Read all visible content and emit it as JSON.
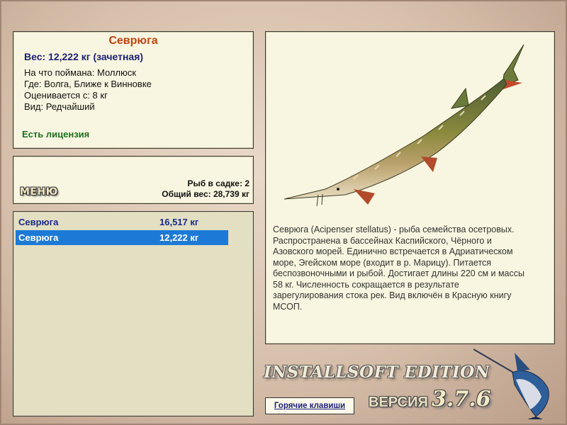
{
  "catch_info": {
    "species": "Севрюга",
    "weight": "Вес: 12,222 кг (зачетная)",
    "caught_on": "На что поймана: Моллюск",
    "location": "Где: Волга, Ближе к Винновке",
    "valued_from": "Оценивается с: 8 кг",
    "rarity": "Вид: Редчайший",
    "license": "Есть лицензия"
  },
  "keepnet": {
    "menu_label": "МЕНЮ",
    "fish_count": "Рыб в садке: 2",
    "total_weight": "Общий вес: 28,739 кг"
  },
  "fish_list": [
    {
      "name": "Севрюга",
      "weight": "16,517 кг",
      "selected": false
    },
    {
      "name": "Севрюга",
      "weight": "12,222 кг",
      "selected": true
    }
  ],
  "description": "Севрюга (Acipenser stellatus) - рыба семейства осетровых. Распространена в бассейнах Каспийского, Чёрного и Азовского морей. Единично встречается в Адриатическом море, Эгейском море (входит в р. Марицу). Питается беспозвоночными и рыбой. Достигает длины 220 см и массы 58 кг. Численность сокращается в результате зарегулирования стока рек. Вид включён в Красную книгу МСОП.",
  "footer": {
    "hotkeys_label": "Горячие клавиши",
    "edition": "INSTALLSOFT EDITION",
    "version_label": "ВЕРСИЯ",
    "version": "3.7.6"
  },
  "icons": {
    "fish_image": "sturgeon-illustration",
    "logo": "marlin-logo"
  },
  "colors": {
    "title": "#c0420f",
    "weight": "#1a1f78",
    "license": "#1f6e1f",
    "selection": "#1c79d6",
    "panel": "#f8f6e0"
  }
}
